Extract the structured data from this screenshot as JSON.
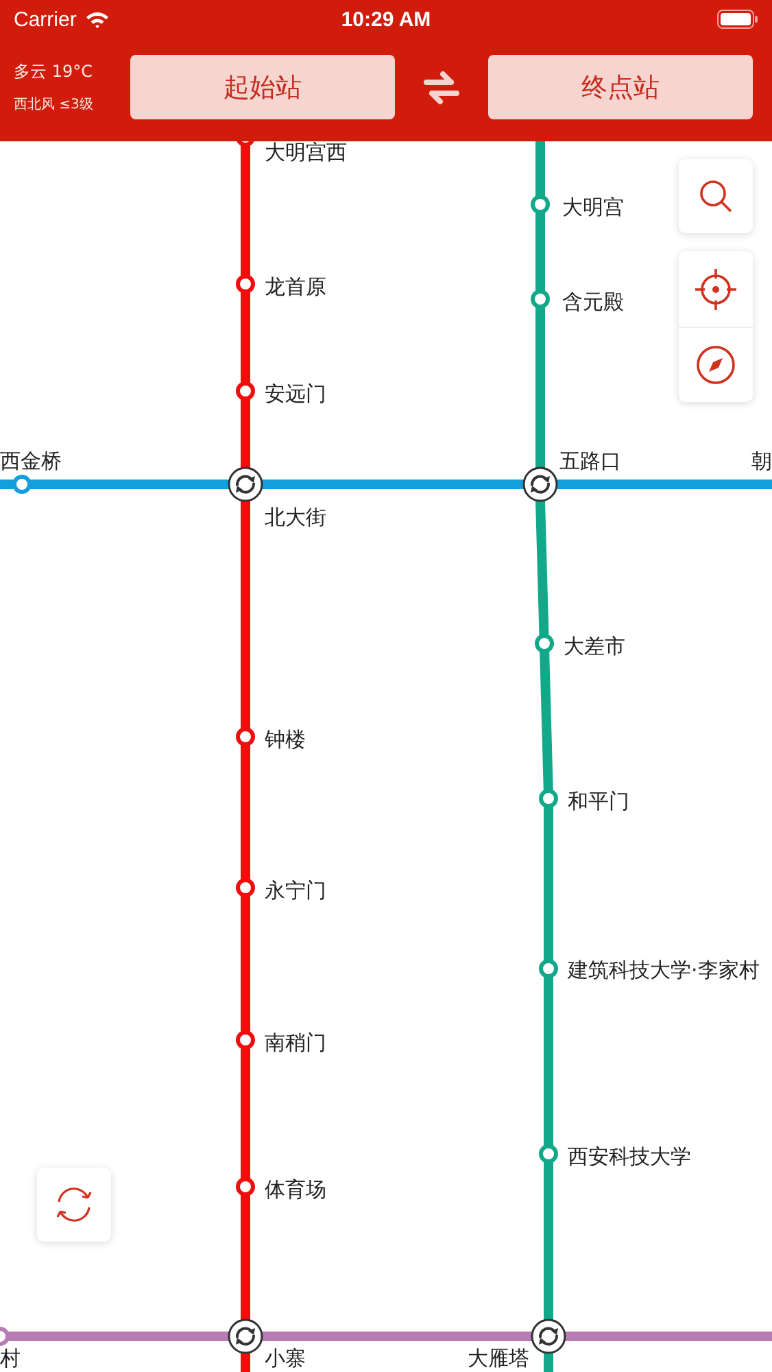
{
  "status_bar": {
    "carrier": "Carrier",
    "time": "10:29 AM"
  },
  "weather": {
    "condition": "多云 19°C",
    "wind": "西北风 ≤3级"
  },
  "route": {
    "start": "起始站",
    "end": "终点站"
  },
  "lines": [
    {
      "color": "#f20d0d"
    },
    {
      "color": "#12a98a"
    },
    {
      "color": "#129fdc"
    },
    {
      "color": "#b57db4"
    }
  ],
  "stations": [
    {
      "name": "大明宫西",
      "kind": "stop"
    },
    {
      "name": "大明宫",
      "kind": "stop"
    },
    {
      "name": "龙首原",
      "kind": "stop"
    },
    {
      "name": "含元殿",
      "kind": "stop"
    },
    {
      "name": "安远门",
      "kind": "stop"
    },
    {
      "name": "西金桥",
      "kind": "stop"
    },
    {
      "name": "五路口",
      "kind": "transfer"
    },
    {
      "name": "朝",
      "kind": "offscreen"
    },
    {
      "name": "北大街",
      "kind": "transfer"
    },
    {
      "name": "大差市",
      "kind": "stop"
    },
    {
      "name": "钟楼",
      "kind": "stop"
    },
    {
      "name": "和平门",
      "kind": "stop"
    },
    {
      "name": "永宁门",
      "kind": "stop"
    },
    {
      "name": "建筑科技大学·李家村",
      "kind": "stop"
    },
    {
      "name": "南稍门",
      "kind": "stop"
    },
    {
      "name": "西安科技大学",
      "kind": "stop"
    },
    {
      "name": "体育场",
      "kind": "stop"
    },
    {
      "name": "村",
      "kind": "stop"
    },
    {
      "name": "小寨",
      "kind": "transfer"
    },
    {
      "name": "大雁塔",
      "kind": "transfer"
    }
  ]
}
